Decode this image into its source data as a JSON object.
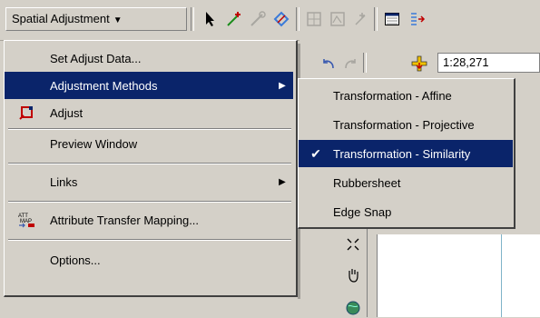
{
  "toolbar": {
    "dropdown_label": "Spatial Adjustment",
    "dropdown_arrow": "▼",
    "icons": [
      "select-arrow-icon",
      "new-displacement-link-icon",
      "modify-link-icon",
      "multi-displacement-link-icon",
      "identity-link-icon",
      "limited-adjustment-area-icon",
      "clear-area-icon",
      "view-link-table-icon",
      "attribute-transfer-icon"
    ]
  },
  "map_window": {
    "scale_value": "1:28,271"
  },
  "menu": {
    "items": [
      {
        "label": "Set Adjust Data...",
        "has_sub": false,
        "icon": "",
        "highlighted": false
      },
      {
        "label": "Adjustment Methods",
        "has_sub": true,
        "icon": "",
        "highlighted": true
      },
      {
        "label": "Adjust",
        "has_sub": false,
        "icon": "adjust-icon",
        "highlighted": false
      },
      {
        "label": "Preview Window",
        "has_sub": false,
        "icon": "",
        "highlighted": false
      },
      {
        "label": "Links",
        "has_sub": true,
        "icon": "",
        "highlighted": false
      },
      {
        "label": "Attribute Transfer Mapping...",
        "has_sub": false,
        "icon": "attribute-transfer-mapping-icon",
        "highlighted": false
      },
      {
        "label": "Options...",
        "has_sub": false,
        "icon": "",
        "highlighted": false
      }
    ],
    "submenu_arrow": "▶"
  },
  "submenu": {
    "items": [
      {
        "label": "Transformation - Affine",
        "checked": false,
        "highlighted": false
      },
      {
        "label": "Transformation - Projective",
        "checked": false,
        "highlighted": false
      },
      {
        "label": "Transformation - Similarity",
        "checked": true,
        "highlighted": true
      },
      {
        "label": "Rubbersheet",
        "checked": false,
        "highlighted": false
      },
      {
        "label": "Edge Snap",
        "checked": false,
        "highlighted": false
      }
    ],
    "check_glyph": "✔"
  },
  "colors": {
    "highlight": "#0a246a",
    "face": "#d4d0c8"
  }
}
